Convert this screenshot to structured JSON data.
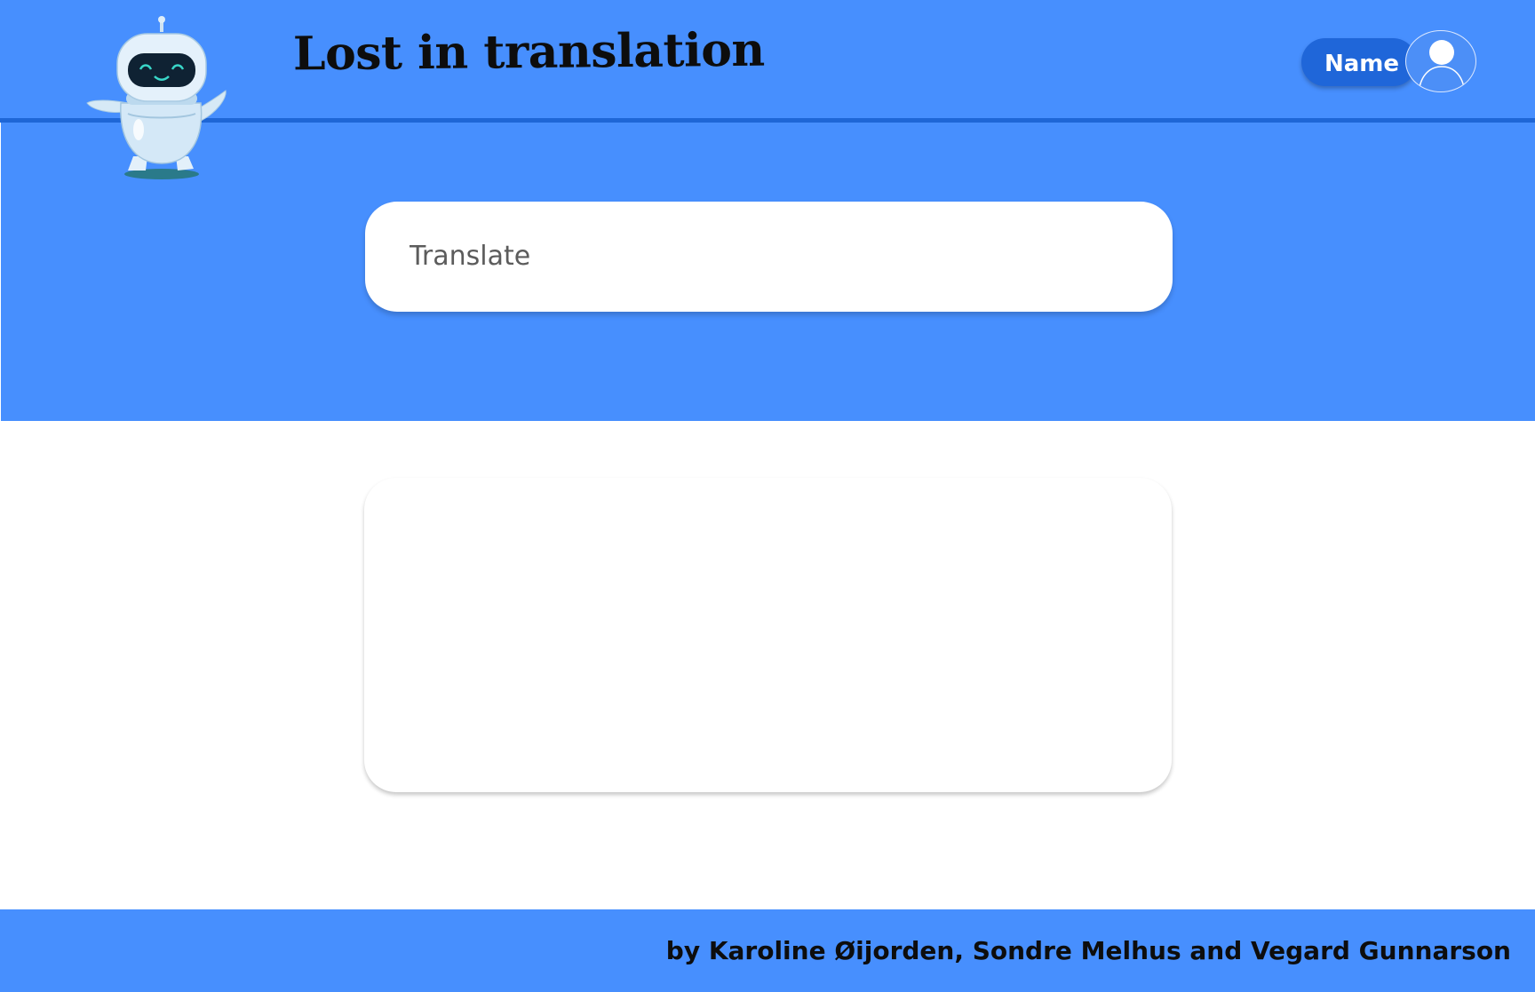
{
  "header": {
    "title": "Lost in translation",
    "logo_icon": "robot-mascot-icon",
    "user": {
      "name": "Name",
      "avatar_icon": "user-avatar-icon"
    }
  },
  "translate": {
    "placeholder": "Translate",
    "value": ""
  },
  "output": {
    "content": ""
  },
  "footer": {
    "credits": "by Karoline Øijorden, Sondre Melhus and Vegard Gunnarson"
  },
  "colors": {
    "brand_blue": "#478ffe",
    "header_border": "#1e66d6",
    "chip_blue": "#1f66d9"
  }
}
